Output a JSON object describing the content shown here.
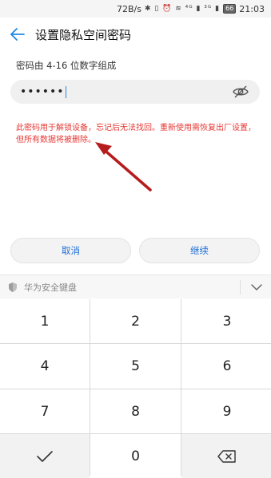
{
  "status_bar": {
    "speed": "72B/s",
    "icons": "✱ ▯ ⏰ ≋ ⁴ᴳ ▮ ³ᴳ ▮",
    "battery": "66",
    "time": "21:03"
  },
  "app_bar": {
    "title": "设置隐私空间密码"
  },
  "form": {
    "hint": "密码由 4-16 位数字组成",
    "password_masked": "••••••",
    "warning": "此密码用于解锁设备，忘记后无法找回。重新使用需恢复出厂设置，但所有数据将被删除。"
  },
  "buttons": {
    "cancel": "取消",
    "continue": "继续"
  },
  "keyboard": {
    "title": "华为安全键盘",
    "keys": [
      "1",
      "2",
      "3",
      "4",
      "5",
      "6",
      "7",
      "8",
      "9",
      "0"
    ]
  },
  "colors": {
    "accent": "#1e88e5",
    "warning": "#e53935",
    "arrow": "#b71c1c"
  },
  "icons": [
    "back-arrow-icon",
    "eye-off-icon",
    "shield-icon",
    "chevron-down-icon",
    "check-icon",
    "backspace-icon"
  ]
}
